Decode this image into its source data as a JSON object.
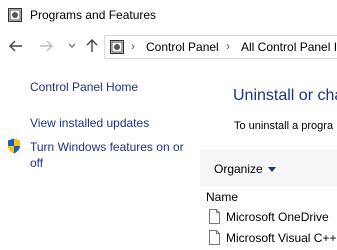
{
  "window": {
    "title": "Programs and Features",
    "icon": "control-panel-icon"
  },
  "nav": {
    "back": "arrow-left-icon",
    "forward": "arrow-right-icon",
    "recent": "chevron-down-icon",
    "up": "arrow-up-icon"
  },
  "address": {
    "icon": "control-panel-icon",
    "separator": "›",
    "segments": [
      "Control Panel",
      "All Control Panel It"
    ]
  },
  "sidebar": {
    "links": [
      {
        "label": "Control Panel Home"
      },
      {
        "label": "View installed updates"
      },
      {
        "label_line1": "Turn Windows features on or",
        "label_line2": "off",
        "icon": "shield-icon"
      }
    ]
  },
  "main": {
    "heading": "Uninstall or cha",
    "description": "To uninstall a progra"
  },
  "toolbar": {
    "organize": "Organize",
    "organize_icon": "caret-down-icon"
  },
  "list": {
    "column_name": "Name",
    "rows": [
      {
        "name": "Microsoft OneDrive",
        "icon": "program-file-icon"
      },
      {
        "name": "Microsoft Visual C++",
        "icon": "program-file-icon"
      }
    ]
  },
  "colors": {
    "link": "#1e3287",
    "cmdbar": "#f5f6f7",
    "border": "#d9d9d9"
  }
}
